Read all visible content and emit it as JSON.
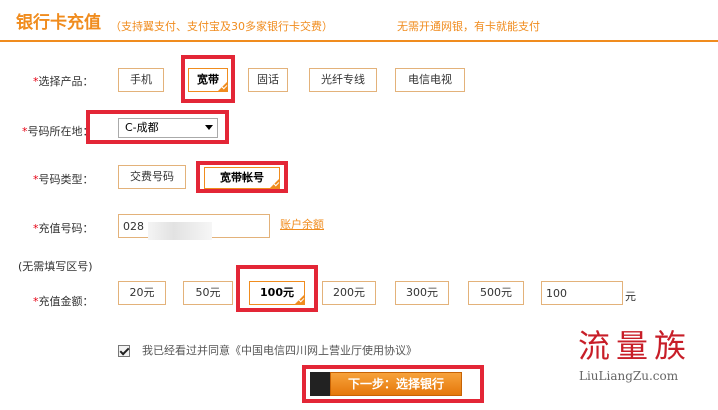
{
  "header": {
    "title": "银行卡充值",
    "subtitle": "（支持翼支付、支付宝及30多家银行卡交费）",
    "note": "无需开通网银，有卡就能支付"
  },
  "product": {
    "label_req": "*",
    "label": "选择产品：",
    "options": [
      "手机",
      "宽带",
      "固话",
      "光纤专线",
      "电信电视"
    ],
    "selected": "宽带"
  },
  "location": {
    "label_req": "*",
    "label": "号码所在地：",
    "value": "C-成都"
  },
  "number_type": {
    "label_req": "*",
    "label": "号码类型：",
    "options": [
      "交费号码",
      "宽带帐号"
    ],
    "selected": "宽带帐号"
  },
  "recharge_number": {
    "label_req": "*",
    "label": "充值号码：",
    "value": "028",
    "balance_link": "账户余额",
    "hint": "(无需填写区号)"
  },
  "amount": {
    "label_req": "*",
    "label": "充值金额：",
    "options": [
      "20元",
      "50元",
      "100元",
      "200元",
      "300元",
      "500元"
    ],
    "selected": "100元",
    "custom_value": "100",
    "unit": "元"
  },
  "agreement": {
    "checked": true,
    "text": "我已经看过并同意《中国电信四川网上营业厅使用协议》"
  },
  "submit_label": "下一步：选择银行",
  "watermark": {
    "text": "流量族",
    "url": "LiuLiangZu.com"
  },
  "colors": {
    "accent": "#f08c1e",
    "highlight_box": "#e32636"
  }
}
